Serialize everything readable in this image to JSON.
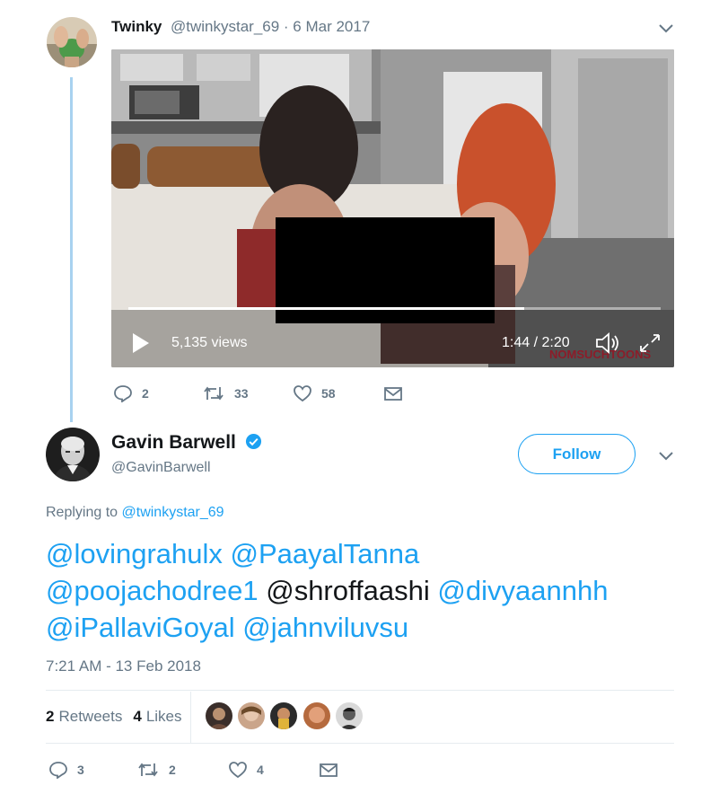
{
  "parent_tweet": {
    "author_name": "Twinky",
    "author_meta": "@twinkystar_69 · 6 Mar 2017",
    "video": {
      "views": "5,135 views",
      "time": "1:44 / 2:20",
      "progress": 0.743,
      "watermark": "NOMSUCHTOONS"
    },
    "actions": {
      "replies": "2",
      "retweets": "33",
      "likes": "58"
    }
  },
  "main_tweet": {
    "author_name": "Gavin Barwell",
    "author_handle": "@GavinBarwell",
    "follow_label": "Follow",
    "replying_prefix": "Replying to",
    "replying_handle": "@twinkystar_69",
    "body": {
      "line1_m1": "@lovingrahulx",
      "line1_m2": "@PaayalTanna",
      "line2_m1": "@poojachodree1",
      "line2_text": "@shroffaashi",
      "line2_m2": "@divyaannhh",
      "line3_m1": "@iPallaviGoyal",
      "line3_m2": "@jahnviluvsu"
    },
    "timestamp": "7:21 AM - 13 Feb 2018",
    "stats": {
      "retweets_count": "2",
      "retweets_label": "Retweets",
      "likes_count": "4",
      "likes_label": "Likes"
    },
    "actions": {
      "replies": "3",
      "retweets": "2",
      "likes": "4"
    }
  },
  "colors": {
    "accent": "#1da1f2",
    "muted": "#657786",
    "thread_line": "#a8d2f0"
  }
}
